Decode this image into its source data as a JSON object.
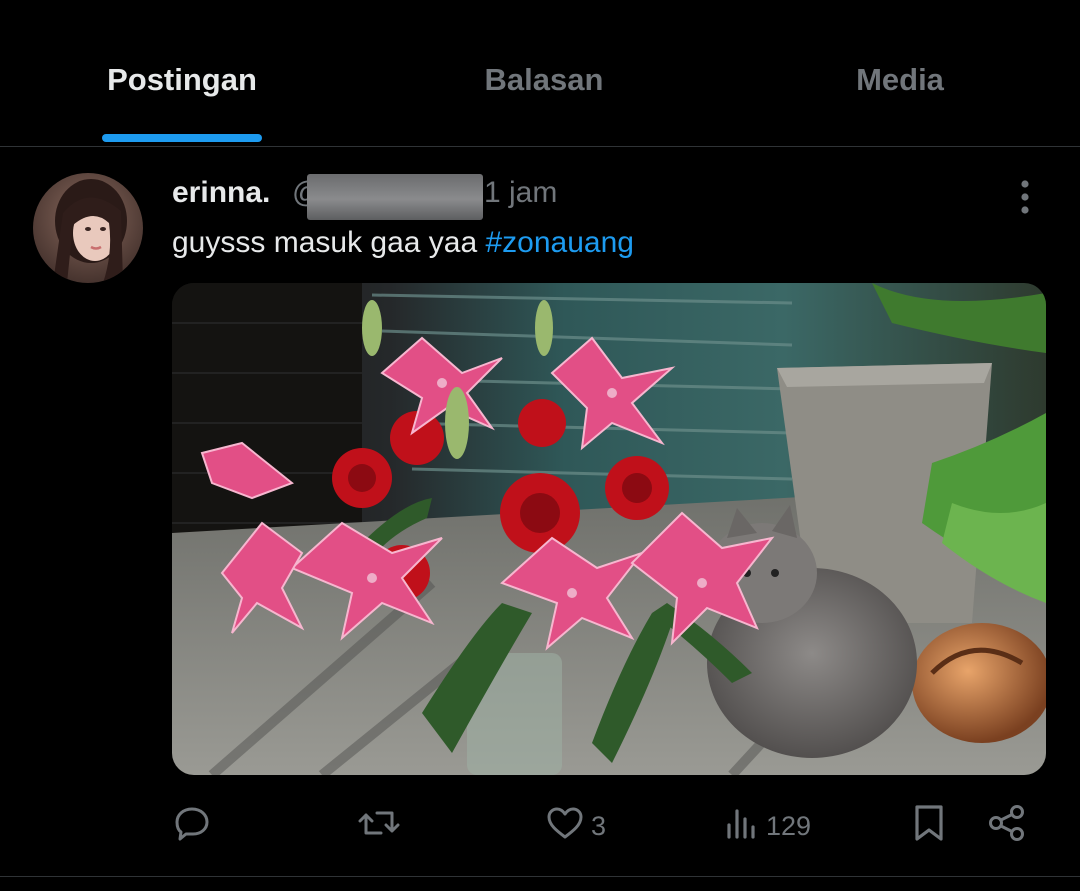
{
  "tabs": [
    {
      "label": "Postingan",
      "active": true
    },
    {
      "label": "Balasan",
      "active": false
    },
    {
      "label": "Media",
      "active": false
    }
  ],
  "accent_color": "#1d9bf0",
  "post": {
    "display_name": "erinna.",
    "handle_prefix": "@",
    "handle_redacted": true,
    "time": "1 jam",
    "text_main": "guysss masuk gaa yaa ",
    "hashtag": "#zonauang",
    "avatar_icon": "profile-photo",
    "image_description": "photo-of-lilies-roses-bouquet-and-cat"
  },
  "actions": {
    "reply_icon": "reply-icon",
    "repost_icon": "repost-icon",
    "like_icon": "heart-icon",
    "like_count": "3",
    "views_icon": "views-icon",
    "views_count": "129",
    "bookmark_icon": "bookmark-icon",
    "share_icon": "share-icon"
  }
}
